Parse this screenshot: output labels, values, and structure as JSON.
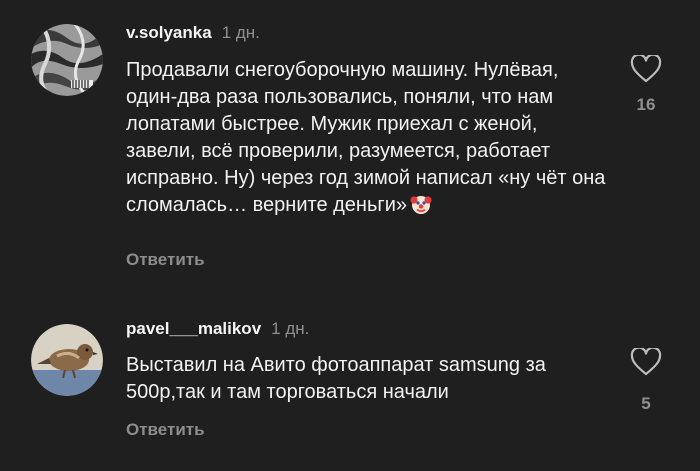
{
  "comments": [
    {
      "username": "v.solyanka",
      "time": "1 дн.",
      "text": "Продавали снегоуборочную машину. Нулёвая, один-два раза пользовались, поняли, что нам лопатами быстрее. Мужик приехал с женой, завели, всё проверили, разумеется, работает исправно. Ну) через год зимой написал «ну чёт она сломалась… верните деньги»",
      "emoji": "clown-face-icon",
      "reply_label": "Ответить",
      "likes": "16",
      "avatar": "bw-abstract-avatar"
    },
    {
      "username": "pavel___malikov",
      "time": "1 дн.",
      "text": "Выставил на Авито фотоаппарат samsung за 500р,так и там торговаться начали",
      "reply_label": "Ответить",
      "likes": "5",
      "avatar": "sparrow-avatar"
    }
  ],
  "colors": {
    "background": "#1f1f1f",
    "text": "#f2f2f2",
    "muted": "#8f8f8f"
  }
}
